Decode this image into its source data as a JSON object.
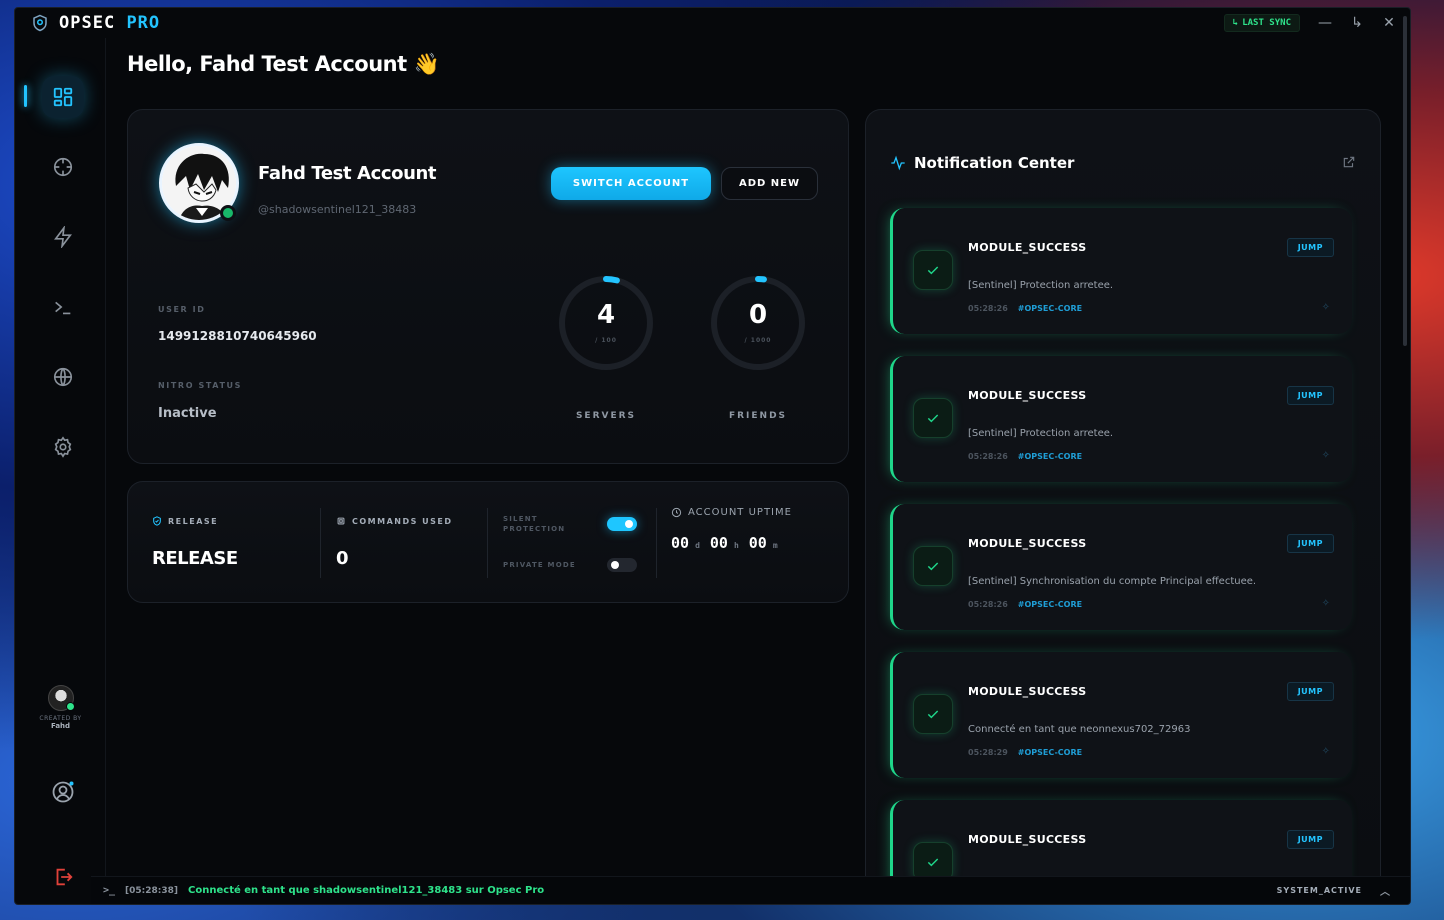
{
  "app": {
    "name_main": "OPSEC",
    "name_accent": "PRO"
  },
  "titlebar": {
    "sync_label": "LAST SYNC"
  },
  "greeting": "Hello, Fahd Test Account 👋",
  "profile": {
    "display_name": "Fahd Test Account",
    "handle": "@shadowsentinel121_38483",
    "switch_label": "SWITCH ACCOUNT",
    "add_label": "ADD NEW",
    "user_id_label": "USER ID",
    "user_id": "1499128810740645960",
    "nitro_label": "NITRO STATUS",
    "nitro_value": "Inactive",
    "servers": {
      "value": "4",
      "max": "/ 100",
      "label": "SERVERS",
      "fraction": 0.04
    },
    "friends": {
      "value": "0",
      "max": "/ 1000",
      "label": "FRIENDS",
      "fraction": 0.0
    }
  },
  "stats": {
    "release_label": "RELEASE",
    "release_value": "RELEASE",
    "commands_label": "COMMANDS USED",
    "commands_value": "0",
    "silent_label": "SILENT PROTECTION",
    "silent_on": true,
    "private_label": "PRIVATE MODE",
    "private_on": false,
    "uptime_label": "ACCOUNT UPTIME",
    "uptime": {
      "d": "00",
      "d_unit": "d",
      "h": "00",
      "h_unit": "h",
      "m": "00",
      "m_unit": "m"
    }
  },
  "creator": {
    "label": "CREATED BY",
    "name": "Fahd"
  },
  "notifications": {
    "title": "Notification Center",
    "items": [
      {
        "title": "MODULE_SUCCESS",
        "jump": "JUMP",
        "message": "[Sentinel] Protection arretee.",
        "time": "05:28:26",
        "tag": "#OPSEC-CORE"
      },
      {
        "title": "MODULE_SUCCESS",
        "jump": "JUMP",
        "message": "[Sentinel] Protection arretee.",
        "time": "05:28:26",
        "tag": "#OPSEC-CORE"
      },
      {
        "title": "MODULE_SUCCESS",
        "jump": "JUMP",
        "message": "[Sentinel] Synchronisation du compte Principal effectuee.",
        "time": "05:28:26",
        "tag": "#OPSEC-CORE"
      },
      {
        "title": "MODULE_SUCCESS",
        "jump": "JUMP",
        "message": "Connecté en tant que neonnexus702_72963",
        "time": "05:28:29",
        "tag": "#OPSEC-CORE"
      },
      {
        "title": "MODULE_SUCCESS",
        "jump": "JUMP",
        "message": "",
        "time": "",
        "tag": ""
      }
    ]
  },
  "statusbar": {
    "prompt": ">_",
    "time": "[05:28:38]",
    "message": "Connecté en tant que shadowsentinel121_38483 sur Opsec Pro",
    "right": "SYSTEM_ACTIVE"
  },
  "colors": {
    "accent": "#23c4ff",
    "success": "#1fd68a",
    "danger": "#e0413a"
  }
}
